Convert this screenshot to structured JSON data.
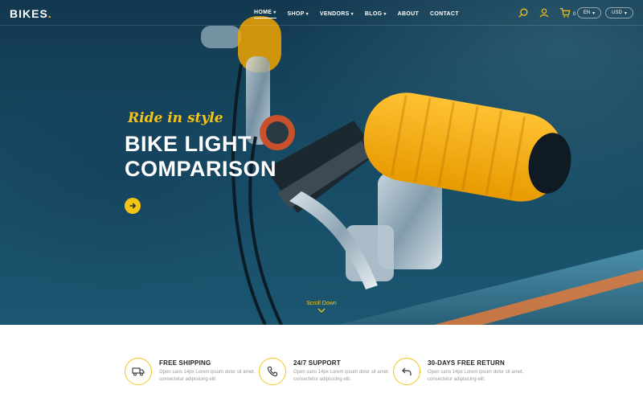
{
  "brand": {
    "name": "BIKES",
    "dot": ".",
    "accent": "#f5c418"
  },
  "nav": {
    "items": [
      {
        "label": "HOME",
        "dropdown": true
      },
      {
        "label": "SHOP",
        "dropdown": true
      },
      {
        "label": "VENDORS",
        "dropdown": true
      },
      {
        "label": "BLOG",
        "dropdown": true
      },
      {
        "label": "ABOUT",
        "dropdown": false
      },
      {
        "label": "CONTACT",
        "dropdown": false
      }
    ],
    "cart_count": "0",
    "language": "EN",
    "currency": "USD",
    "icons": [
      "search-icon",
      "user-icon",
      "cart-icon"
    ]
  },
  "hero": {
    "tagline": "Ride in style",
    "headline_line1": "BIKE LIGHT",
    "headline_line2": "COMPARISON",
    "scroll_label": "Scroll Down"
  },
  "features": [
    {
      "title": "FREE SHIPPING",
      "desc": "Open sans 14px Lorem ipsum dolor sit amet, consectetur adipisicing elit.",
      "icon": "truck-icon"
    },
    {
      "title": "24/7 SUPPORT",
      "desc": "Open sans 14px Lorem ipsum dolor sit amet, consectetur adipisicing elit.",
      "icon": "phone-icon"
    },
    {
      "title": "30-DAYS FREE RETURN",
      "desc": "Open sans 14px Lorem ipsum dolor sit amet, consectetur adipisicing elit.",
      "icon": "return-icon"
    }
  ]
}
